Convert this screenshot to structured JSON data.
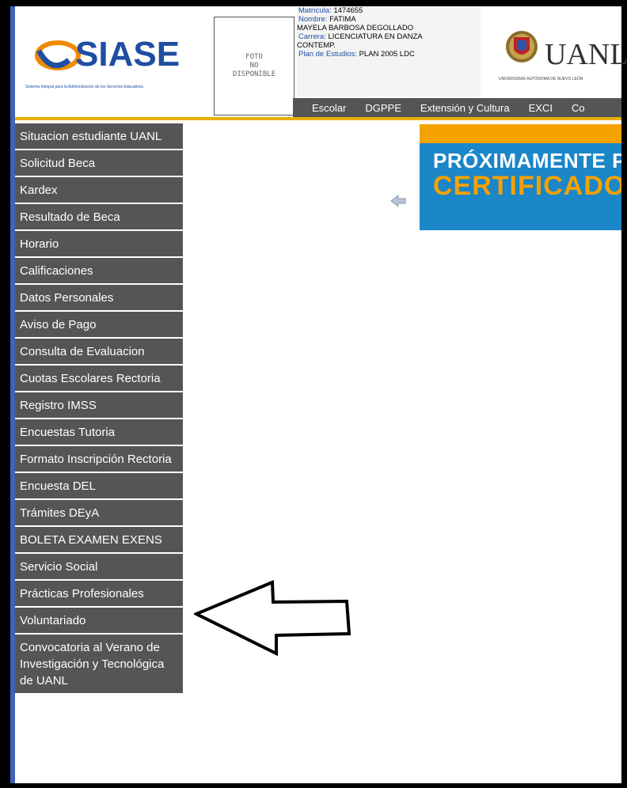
{
  "header": {
    "logo_text": "SIASE",
    "logo_subtitle": "Sistema Integral para la Administración de los Servicios Educativos",
    "photo_lines": [
      "FOTO",
      "NO",
      "DISPONIBLE"
    ],
    "student": {
      "matricula_label": "Matrícula:",
      "matricula_value": "1474655",
      "nombre_label": "Nombre:",
      "nombre_value_1": "FATIMA",
      "nombre_value_2": "MAYELA BARBOSA DEGOLLADO",
      "carrera_label": "Carrera:",
      "carrera_value_1": "LICENCIATURA EN DANZA",
      "carrera_value_2": "CONTEMP.",
      "plan_label": "Plan de Estudios:",
      "plan_value": "PLAN 2005 LDC"
    },
    "university_text": "UANL",
    "university_subtitle": "UNIVERSIDAD AUTÓNOMA DE NUEVO LEÓN"
  },
  "topnav": [
    "Escolar",
    "DGPPE",
    "Extensión y Cultura",
    "EXCI",
    "Co"
  ],
  "sidebar": [
    "Situacion estudiante UANL",
    "Solicitud Beca",
    "Kardex",
    "Resultado de Beca",
    "Horario",
    "Calificaciones",
    "Datos Personales",
    "Aviso de Pago",
    "Consulta de Evaluacion",
    "Cuotas Escolares Rectoria",
    "Registro IMSS",
    "Encuestas Tutoria",
    "Formato Inscripción Rectoria",
    "Encuesta DEL",
    "Trámites DEyA",
    "BOLETA EXAMEN EXENS",
    "Servicio Social",
    "Prácticas Profesionales",
    "Voluntariado",
    "Convocatoria al Verano de Investigación y Tecnológica de UANL"
  ],
  "banner": {
    "line1": "PRÓXIMAMENTE PO",
    "line2": "CERTIFICADO"
  },
  "colors": {
    "nav_bg": "#555555",
    "brand_blue": "#1f4ea3",
    "gold": "#e8b000",
    "banner_blue": "#1b86c8",
    "banner_orange": "#f4a200"
  },
  "icons": [
    "siase-logo-icon",
    "uanl-seal-icon",
    "back-arrow-icon",
    "annotation-arrow-icon"
  ]
}
